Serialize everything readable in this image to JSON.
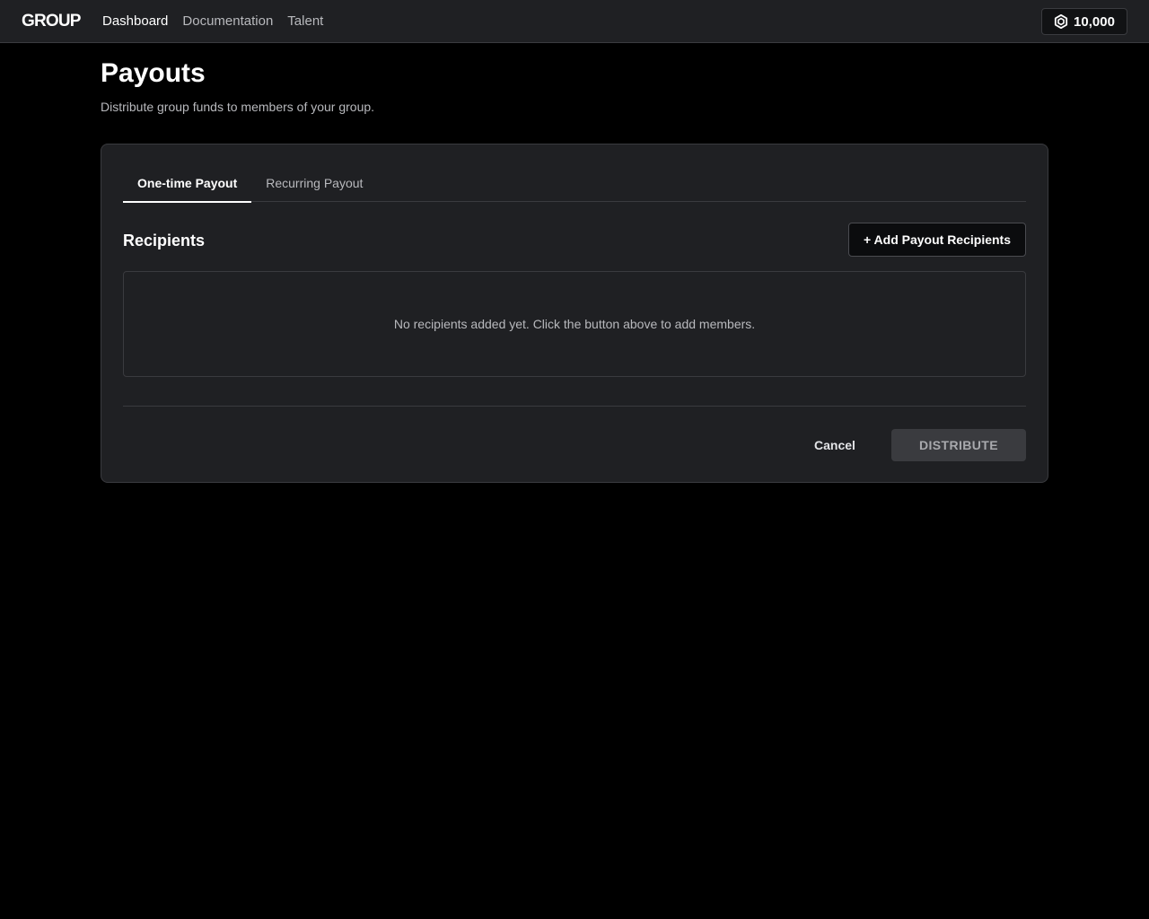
{
  "header": {
    "brand": "GROUP",
    "nav": [
      {
        "label": "Dashboard",
        "active": true
      },
      {
        "label": "Documentation",
        "active": false
      },
      {
        "label": "Talent",
        "active": false
      }
    ],
    "balance": {
      "icon": "robux-icon",
      "amount": "10,000"
    }
  },
  "page": {
    "title": "Payouts",
    "subtitle": "Distribute group funds to members of your group."
  },
  "card": {
    "tabs": [
      {
        "label": "One-time Payout",
        "active": true
      },
      {
        "label": "Recurring Payout",
        "active": false
      }
    ],
    "recipients": {
      "title": "Recipients",
      "add_button": "+ Add Payout Recipients",
      "empty_message": "No recipients added yet. Click the button above to add members."
    },
    "actions": {
      "cancel": "Cancel",
      "distribute": "DISTRIBUTE",
      "distribute_disabled": true
    }
  },
  "colors": {
    "background": "#000000",
    "surface": "#1f2023",
    "border": "#3a3b3f",
    "text_primary": "#ffffff",
    "text_secondary": "#b8b9bd",
    "disabled_button": "#3a3b3f"
  }
}
